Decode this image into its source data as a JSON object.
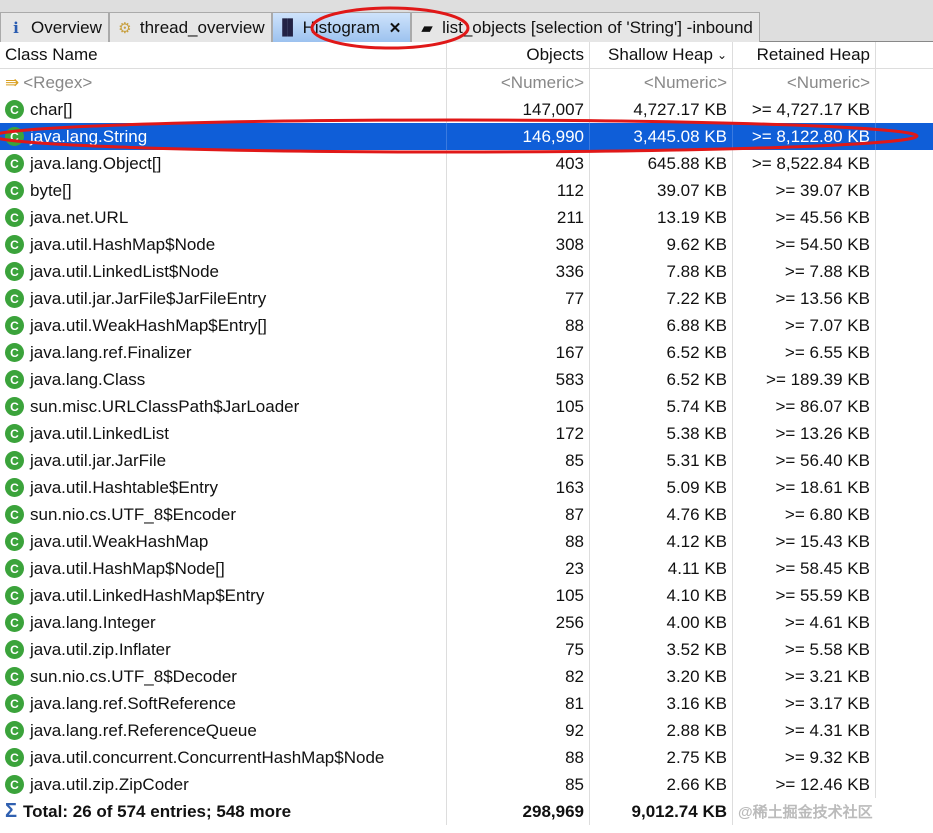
{
  "tabs": [
    {
      "label": "Overview",
      "icon": "info-icon"
    },
    {
      "label": "thread_overview",
      "icon": "gear-icon"
    },
    {
      "label": "Histogram",
      "icon": "histogram-icon",
      "active": true
    },
    {
      "label": "list_objects  [selection of 'String'] -inbound",
      "icon": "document-icon"
    }
  ],
  "columns": {
    "name": "Class Name",
    "objects": "Objects",
    "shallow": "Shallow Heap",
    "retained": "Retained Heap"
  },
  "filter": {
    "name": "<Regex>",
    "objects": "<Numeric>",
    "shallow": "<Numeric>",
    "retained": "<Numeric>"
  },
  "rows": [
    [
      "char[]",
      "147,007",
      "4,727.17 KB",
      ">= 4,727.17 KB"
    ],
    [
      "java.lang.String",
      "146,990",
      "3,445.08 KB",
      ">= 8,122.80 KB"
    ],
    [
      "java.lang.Object[]",
      "403",
      "645.88 KB",
      ">= 8,522.84 KB"
    ],
    [
      "byte[]",
      "112",
      "39.07 KB",
      ">= 39.07 KB"
    ],
    [
      "java.net.URL",
      "211",
      "13.19 KB",
      ">= 45.56 KB"
    ],
    [
      "java.util.HashMap$Node",
      "308",
      "9.62 KB",
      ">= 54.50 KB"
    ],
    [
      "java.util.LinkedList$Node",
      "336",
      "7.88 KB",
      ">= 7.88 KB"
    ],
    [
      "java.util.jar.JarFile$JarFileEntry",
      "77",
      "7.22 KB",
      ">= 13.56 KB"
    ],
    [
      "java.util.WeakHashMap$Entry[]",
      "88",
      "6.88 KB",
      ">= 7.07 KB"
    ],
    [
      "java.lang.ref.Finalizer",
      "167",
      "6.52 KB",
      ">= 6.55 KB"
    ],
    [
      "java.lang.Class",
      "583",
      "6.52 KB",
      ">= 189.39 KB"
    ],
    [
      "sun.misc.URLClassPath$JarLoader",
      "105",
      "5.74 KB",
      ">= 86.07 KB"
    ],
    [
      "java.util.LinkedList",
      "172",
      "5.38 KB",
      ">= 13.26 KB"
    ],
    [
      "java.util.jar.JarFile",
      "85",
      "5.31 KB",
      ">= 56.40 KB"
    ],
    [
      "java.util.Hashtable$Entry",
      "163",
      "5.09 KB",
      ">= 18.61 KB"
    ],
    [
      "sun.nio.cs.UTF_8$Encoder",
      "87",
      "4.76 KB",
      ">= 6.80 KB"
    ],
    [
      "java.util.WeakHashMap",
      "88",
      "4.12 KB",
      ">= 15.43 KB"
    ],
    [
      "java.util.HashMap$Node[]",
      "23",
      "4.11 KB",
      ">= 58.45 KB"
    ],
    [
      "java.util.LinkedHashMap$Entry",
      "105",
      "4.10 KB",
      ">= 55.59 KB"
    ],
    [
      "java.lang.Integer",
      "256",
      "4.00 KB",
      ">= 4.61 KB"
    ],
    [
      "java.util.zip.Inflater",
      "75",
      "3.52 KB",
      ">= 5.58 KB"
    ],
    [
      "sun.nio.cs.UTF_8$Decoder",
      "82",
      "3.20 KB",
      ">= 3.21 KB"
    ],
    [
      "java.lang.ref.SoftReference",
      "81",
      "3.16 KB",
      ">= 3.17 KB"
    ],
    [
      "java.lang.ref.ReferenceQueue",
      "92",
      "2.88 KB",
      ">= 4.31 KB"
    ],
    [
      "java.util.concurrent.ConcurrentHashMap$Node",
      "88",
      "2.75 KB",
      ">= 9.32 KB"
    ],
    [
      "java.util.zip.ZipCoder",
      "85",
      "2.66 KB",
      ">= 12.46 KB"
    ]
  ],
  "selected_index": 1,
  "total": {
    "label": "Total: 26 of 574 entries; 548 more",
    "objects": "298,969",
    "shallow": "9,012.74 KB"
  },
  "watermark": "@稀土掘金技术社区",
  "accent": "#0f5ed8"
}
